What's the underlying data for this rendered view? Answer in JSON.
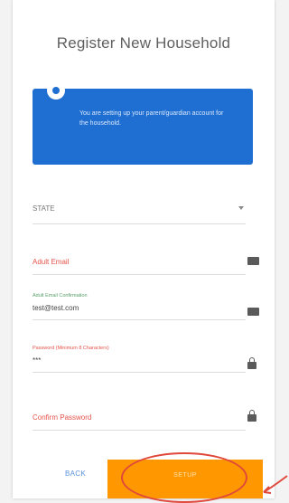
{
  "form": {
    "title": "Register New Household",
    "info_text": "You are setting up your parent/guardian account for the household.",
    "state": {
      "value": "STATE"
    },
    "fields": [
      {
        "label": "Adult Email",
        "value": "",
        "icon": "email-icon"
      },
      {
        "label": "Adult Email Confirmation",
        "value": "test@test.com",
        "icon": "email-icon"
      },
      {
        "label": "Password (Minimum 8 Characters)",
        "value": "***",
        "icon": "lock-icon"
      },
      {
        "label": "Confirm Password",
        "value": "",
        "icon": "lock-icon"
      }
    ],
    "back_label": "BACK",
    "next_label": "SETUP"
  },
  "colors": {
    "accent_blue": "#1f6fd2",
    "label_red": "#e5534b",
    "label_green": "#5aa06a",
    "button_orange": "#ff9800",
    "annotation_red": "#e0483b"
  }
}
